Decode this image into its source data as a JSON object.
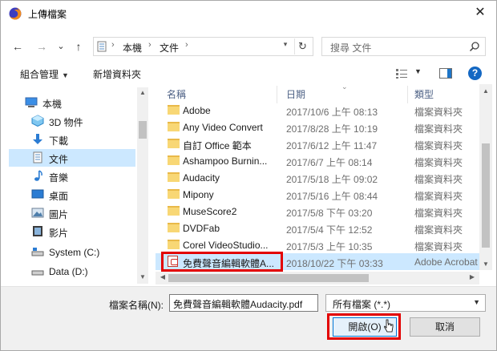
{
  "window": {
    "title": "上傳檔案"
  },
  "nav": {
    "back": "←",
    "forward": "→",
    "recent": "⌄",
    "up": "↑",
    "breadcrumbs": [
      "本機",
      "文件"
    ],
    "refresh": "↻",
    "search_placeholder": "搜尋 文件"
  },
  "toolbar": {
    "organize": "組合管理",
    "new_folder": "新增資料夾",
    "help": "?"
  },
  "sidebar": {
    "items": [
      {
        "label": "本機",
        "icon": "computer-icon"
      },
      {
        "label": "3D 物件",
        "icon": "3d-objects-icon"
      },
      {
        "label": "下載",
        "icon": "download-icon"
      },
      {
        "label": "文件",
        "icon": "documents-icon"
      },
      {
        "label": "音樂",
        "icon": "music-icon"
      },
      {
        "label": "桌面",
        "icon": "desktop-icon"
      },
      {
        "label": "圖片",
        "icon": "pictures-icon"
      },
      {
        "label": "影片",
        "icon": "videos-icon"
      },
      {
        "label": "System (C:)",
        "icon": "drive-icon"
      },
      {
        "label": "Data (D:)",
        "icon": "drive-icon"
      }
    ]
  },
  "files": {
    "columns": [
      "名稱",
      "日期",
      "類型"
    ],
    "rows": [
      {
        "name": "Adobe",
        "date": "2017/10/6 上午 08:13",
        "type": "檔案資料夾",
        "kind": "folder"
      },
      {
        "name": "Any Video Convert",
        "date": "2017/8/28 上午 10:19",
        "type": "檔案資料夾",
        "kind": "folder"
      },
      {
        "name": "自訂 Office 範本",
        "date": "2017/6/12 上午 11:47",
        "type": "檔案資料夾",
        "kind": "folder"
      },
      {
        "name": "Ashampoo Burnin...",
        "date": "2017/6/7 上午 08:14",
        "type": "檔案資料夾",
        "kind": "folder"
      },
      {
        "name": "Audacity",
        "date": "2017/5/18 上午 09:02",
        "type": "檔案資料夾",
        "kind": "folder"
      },
      {
        "name": "Mipony",
        "date": "2017/5/16 上午 08:44",
        "type": "檔案資料夾",
        "kind": "folder"
      },
      {
        "name": "MuseScore2",
        "date": "2017/5/8 下午 03:20",
        "type": "檔案資料夾",
        "kind": "folder"
      },
      {
        "name": "DVDFab",
        "date": "2017/5/4 下午 12:52",
        "type": "檔案資料夾",
        "kind": "folder"
      },
      {
        "name": "Corel VideoStudio...",
        "date": "2017/5/3 上午 10:35",
        "type": "檔案資料夾",
        "kind": "folder"
      },
      {
        "name": "免費聲音編輯軟體A...",
        "date": "2018/10/22 下午 03:33",
        "type": "Adobe Acrobat",
        "kind": "pdf"
      }
    ]
  },
  "bottom": {
    "filename_label": "檔案名稱(N):",
    "filename_value": "免費聲音編輯軟體Audacity.pdf",
    "filter_value": "所有檔案 (*.*)",
    "open_label": "開啟(O)",
    "cancel_label": "取消"
  },
  "colors": {
    "selection": "#cce8ff",
    "highlight": "#e30000",
    "accent": "#0078d7"
  }
}
